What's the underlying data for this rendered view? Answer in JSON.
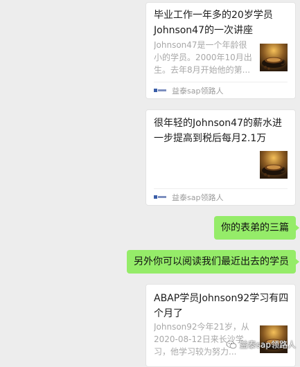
{
  "messages": [
    {
      "kind": "article-card",
      "title": "毕业工作一年多的20岁学员Johnson47的一次讲座",
      "description": "Johnson47是一个年龄很小的学员。2000年10月出生。去年8月开始他的第...",
      "source": "益泰sap领路人",
      "thumbnail_icon": "coffee-cup-thumbnail"
    },
    {
      "kind": "article-card",
      "title": "很年轻的Johnson47的薪水进一步提高到税后每月2.1万",
      "description": "",
      "source": "益泰sap领路人",
      "thumbnail_icon": "coffee-cup-thumbnail"
    },
    {
      "kind": "text-bubble",
      "text": "你的表弟的三篇"
    },
    {
      "kind": "text-bubble",
      "text": "另外你可以阅读我们最近出去的学员"
    },
    {
      "kind": "article-card",
      "title": "ABAP学员Johnson92学习有四个月了",
      "description": "Johnson92今年21岁，从2020-08-12日来长沙学习，他学习较为努力...",
      "source": "益泰sap领路人",
      "thumbnail_icon": "coffee-cup-thumbnail"
    }
  ],
  "watermark": {
    "text": "益泰sap领路人",
    "icon": "wechat-official-account-icon"
  },
  "colors": {
    "chat_background": "#ededed",
    "sent_bubble": "#95ec69",
    "card_background": "#ffffff",
    "secondary_text": "#a8a8a8"
  }
}
